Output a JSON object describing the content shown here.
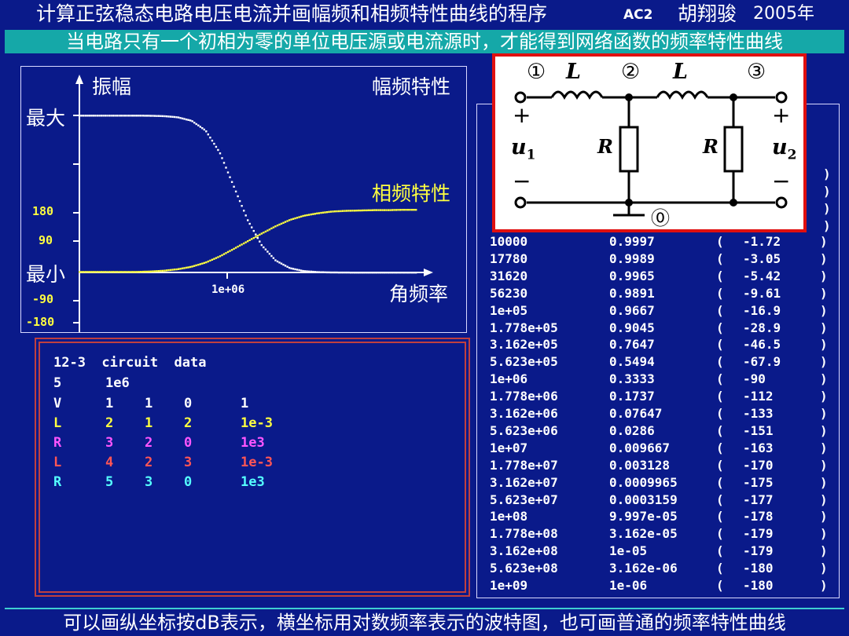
{
  "header": {
    "title": "计算正弦稳态电路电压电流并画幅频和相频特性曲线的程序",
    "program_tag": "AC2",
    "author": "胡翔骏",
    "year": "2005年"
  },
  "subtitle": "当电路只有一个初相为零的单位电压源或电流源时，才能得到网络函数的频率特性曲线",
  "footer": "可以画纵坐标按dB表示，横坐标用对数频率表示的波特图，也可画普通的频率特性曲线",
  "plot": {
    "y_axis_label": "振幅",
    "max_label": "最大",
    "min_label": "最小",
    "mag_title": "幅频特性",
    "phase_title": "相频特性",
    "x_axis_label": "角频率",
    "x_tick": "1e+06",
    "phase_ticks": [
      "180",
      "90",
      "-90",
      "-180"
    ]
  },
  "circuit_data": {
    "title": "12-3  circuit  data",
    "settings": [
      "5",
      "1e6"
    ],
    "elements": [
      {
        "type": "V",
        "id": "1",
        "n1": "1",
        "n2": "0",
        "value": "1",
        "color": "#ffffff"
      },
      {
        "type": "L",
        "id": "2",
        "n1": "1",
        "n2": "2",
        "value": "1e-3",
        "color": "#ffff40"
      },
      {
        "type": "R",
        "id": "3",
        "n1": "2",
        "n2": "0",
        "value": "1e3",
        "color": "#ff55ff"
      },
      {
        "type": "L",
        "id": "4",
        "n1": "2",
        "n2": "3",
        "value": "1e-3",
        "color": "#ff5555"
      },
      {
        "type": "R",
        "id": "5",
        "n1": "3",
        "n2": "0",
        "value": "1e3",
        "color": "#55ffff"
      }
    ]
  },
  "diagram": {
    "node_labels": [
      "①",
      "②",
      "③",
      "⓪"
    ],
    "inductor_label": "L",
    "resistor_label": "R",
    "input_voltage": "u",
    "input_sub": "1",
    "output_voltage": "u",
    "output_sub": "2",
    "plus": "+",
    "minus": "−"
  },
  "chart_data": {
    "type": "line",
    "title": "",
    "xlabel": "角频率",
    "ylabel": "振幅",
    "x_scale": "log",
    "xlim": [
      1000,
      1000000000
    ],
    "x": [
      10000,
      17780,
      31620,
      56230,
      100000,
      177800,
      316200,
      562300,
      1000000,
      1778000,
      3162000,
      5623000,
      10000000,
      17780000,
      31620000,
      56230000,
      100000000,
      177800000,
      316200000,
      562300000,
      1000000000
    ],
    "series": [
      {
        "values": [
          0.9997,
          0.9989,
          0.9965,
          0.9891,
          0.9667,
          0.9045,
          0.7647,
          0.5494,
          0.3333,
          0.1737,
          0.07647,
          0.0286,
          0.009667,
          0.003128,
          0.0009965,
          0.0003159,
          9.997e-05,
          3.162e-05,
          1e-05,
          3.162e-06,
          1e-06
        ]
      },
      {
        "values": [
          -1.72,
          -3.05,
          -5.42,
          -9.61,
          -16.9,
          -28.9,
          -46.5,
          -67.9,
          -90,
          -112,
          -133,
          -151,
          -163,
          -170,
          -175,
          -177,
          -178,
          -179,
          -179,
          -180,
          -180
        ]
      }
    ],
    "phase_ylim": [
      -180,
      180
    ],
    "magnitude_color": "#ffffff",
    "phase_color": "#ffff40"
  },
  "results": {
    "rows": [
      [
        "10000",
        "0.9997",
        "(",
        "-1.72",
        ")"
      ],
      [
        "17780",
        "0.9989",
        "(",
        "-3.05",
        ")"
      ],
      [
        "31620",
        "0.9965",
        "(",
        "-5.42",
        ")"
      ],
      [
        "56230",
        "0.9891",
        "(",
        "-9.61",
        ")"
      ],
      [
        "1e+05",
        "0.9667",
        "(",
        "-16.9",
        ")"
      ],
      [
        "1.778e+05",
        "0.9045",
        "(",
        "-28.9",
        ")"
      ],
      [
        "3.162e+05",
        "0.7647",
        "(",
        "-46.5",
        ")"
      ],
      [
        "5.623e+05",
        "0.5494",
        "(",
        "-67.9",
        ")"
      ],
      [
        "1e+06",
        "0.3333",
        "(",
        "-90",
        ")"
      ],
      [
        "1.778e+06",
        "0.1737",
        "(",
        "-112",
        ")"
      ],
      [
        "3.162e+06",
        "0.07647",
        "(",
        "-133",
        ")"
      ],
      [
        "5.623e+06",
        "0.0286",
        "(",
        "-151",
        ")"
      ],
      [
        "1e+07",
        "0.009667",
        "(",
        "-163",
        ")"
      ],
      [
        "1.778e+07",
        "0.003128",
        "(",
        "-170",
        ")"
      ],
      [
        "3.162e+07",
        "0.0009965",
        "(",
        "-175",
        ")"
      ],
      [
        "5.623e+07",
        "0.0003159",
        "(",
        "-177",
        ")"
      ],
      [
        "1e+08",
        "9.997e-05",
        "(",
        "-178",
        ")"
      ],
      [
        "1.778e+08",
        "3.162e-05",
        "(",
        "-179",
        ")"
      ],
      [
        "3.162e+08",
        "1e-05",
        "(",
        "-179",
        ")"
      ],
      [
        "5.623e+08",
        "3.162e-06",
        "(",
        "-180",
        ")"
      ],
      [
        "1e+09",
        "1e-06",
        "(",
        "-180",
        ")"
      ]
    ],
    "hidden_right_marks": [
      ")",
      ")",
      ")",
      ")"
    ]
  }
}
